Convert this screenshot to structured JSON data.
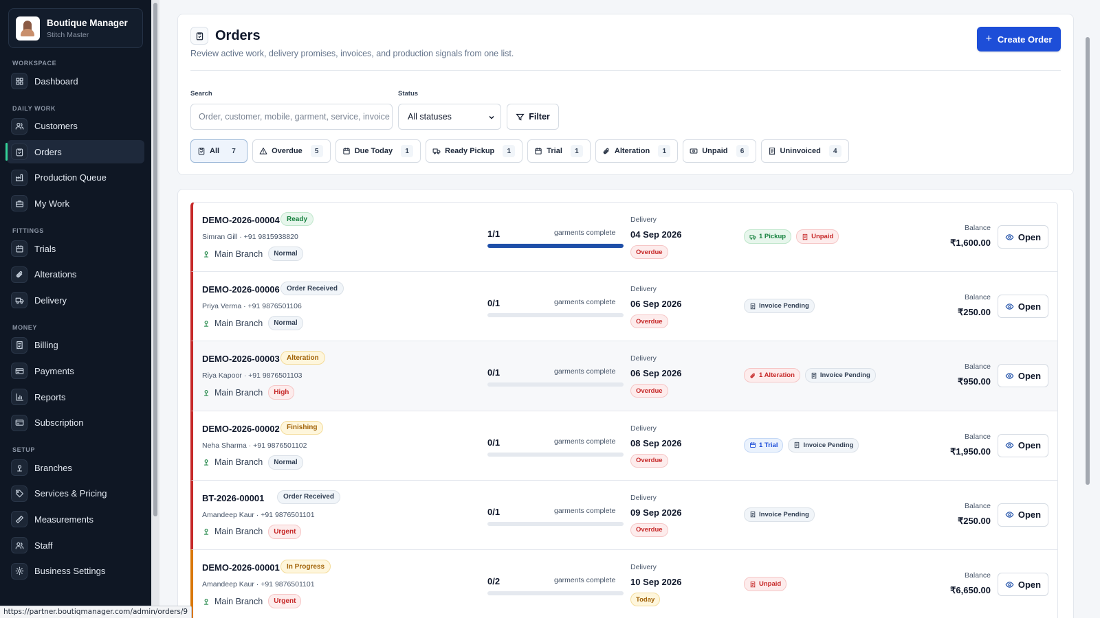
{
  "brand": {
    "name": "Boutique Manager",
    "subtitle": "Stitch Master"
  },
  "sidebar": {
    "sections": [
      {
        "label": "Workspace",
        "items": [
          {
            "label": "Dashboard",
            "icon": "dashboard-icon"
          }
        ]
      },
      {
        "label": "Daily Work",
        "items": [
          {
            "label": "Customers",
            "icon": "users-icon"
          },
          {
            "label": "Orders",
            "icon": "clipboard-icon",
            "active": true
          },
          {
            "label": "Production Queue",
            "icon": "factory-icon"
          },
          {
            "label": "My Work",
            "icon": "briefcase-icon"
          }
        ]
      },
      {
        "label": "Fittings",
        "items": [
          {
            "label": "Trials",
            "icon": "calendar-icon"
          },
          {
            "label": "Alterations",
            "icon": "paperclip-icon"
          },
          {
            "label": "Delivery",
            "icon": "truck-icon"
          }
        ]
      },
      {
        "label": "Money",
        "items": [
          {
            "label": "Billing",
            "icon": "receipt-icon"
          },
          {
            "label": "Payments",
            "icon": "card-icon"
          },
          {
            "label": "Reports",
            "icon": "chart-icon"
          },
          {
            "label": "Subscription",
            "icon": "card-icon"
          }
        ]
      },
      {
        "label": "Setup",
        "items": [
          {
            "label": "Branches",
            "icon": "pin-icon"
          },
          {
            "label": "Services & Pricing",
            "icon": "tag-icon"
          },
          {
            "label": "Measurements",
            "icon": "ruler-icon"
          },
          {
            "label": "Staff",
            "icon": "users-icon"
          },
          {
            "label": "Business Settings",
            "icon": "gear-icon"
          }
        ]
      }
    ]
  },
  "header": {
    "title": "Orders",
    "subtitle": "Review active work, delivery promises, invoices, and production signals from one list.",
    "create_label": "Create Order"
  },
  "filters": {
    "search_label": "Search",
    "search_placeholder": "Order, customer, mobile, garment, service, invoice",
    "status_label": "Status",
    "status_value": "All statuses",
    "filter_label": "Filter",
    "chips": [
      {
        "label": "All",
        "count": "7",
        "icon": "clipboard-icon",
        "active": true
      },
      {
        "label": "Overdue",
        "count": "5",
        "icon": "warning-icon"
      },
      {
        "label": "Due Today",
        "count": "1",
        "icon": "calendar-icon"
      },
      {
        "label": "Ready Pickup",
        "count": "1",
        "icon": "truck-icon"
      },
      {
        "label": "Trial",
        "count": "1",
        "icon": "calendar-icon"
      },
      {
        "label": "Alteration",
        "count": "1",
        "icon": "paperclip-icon"
      },
      {
        "label": "Unpaid",
        "count": "6",
        "icon": "cash-icon"
      },
      {
        "label": "Uninvoiced",
        "count": "4",
        "icon": "receipt-icon"
      }
    ]
  },
  "orders": [
    {
      "number": "DEMO-2026-00004",
      "status": "Ready",
      "status_kind": "ready",
      "customer": "Simran Gill · +91 9815938820",
      "branch": "Main Branch",
      "priority": "Normal",
      "priority_kind": "normal",
      "garments": "1/1",
      "progress": 1.0,
      "garments_label": "garments complete",
      "delivery_label": "Delivery",
      "delivery_date": "04 Sep 2026",
      "delivery_tag": "Overdue",
      "delivery_tag_kind": "overdue",
      "signals": [
        {
          "label": "1 Pickup",
          "kind": "pickup",
          "icon": "truck-icon"
        },
        {
          "label": "Unpaid",
          "kind": "unpaid",
          "icon": "receipt-icon"
        }
      ],
      "balance_label": "Balance",
      "balance": "₹1,600.00",
      "open_label": "Open",
      "accent": "red"
    },
    {
      "number": "DEMO-2026-00006",
      "status": "Order Received",
      "status_kind": "received",
      "customer": "Priya Verma · +91 9876501106",
      "branch": "Main Branch",
      "priority": "Normal",
      "priority_kind": "normal",
      "garments": "0/1",
      "progress": 0,
      "garments_label": "garments complete",
      "delivery_label": "Delivery",
      "delivery_date": "06 Sep 2026",
      "delivery_tag": "Overdue",
      "delivery_tag_kind": "overdue",
      "signals": [
        {
          "label": "Invoice Pending",
          "kind": "pending",
          "icon": "receipt-icon"
        }
      ],
      "balance_label": "Balance",
      "balance": "₹250.00",
      "open_label": "Open",
      "accent": "red"
    },
    {
      "number": "DEMO-2026-00003",
      "status": "Alteration",
      "status_kind": "alteration",
      "customer": "Riya Kapoor · +91 9876501103",
      "branch": "Main Branch",
      "priority": "High",
      "priority_kind": "high",
      "garments": "0/1",
      "progress": 0,
      "garments_label": "garments complete",
      "delivery_label": "Delivery",
      "delivery_date": "06 Sep 2026",
      "delivery_tag": "Overdue",
      "delivery_tag_kind": "overdue",
      "signals": [
        {
          "label": "1 Alteration",
          "kind": "alter",
          "icon": "paperclip-icon"
        },
        {
          "label": "Invoice Pending",
          "kind": "pending",
          "icon": "receipt-icon"
        }
      ],
      "balance_label": "Balance",
      "balance": "₹950.00",
      "open_label": "Open",
      "accent": "red",
      "highlight": true
    },
    {
      "number": "DEMO-2026-00002",
      "status": "Finishing",
      "status_kind": "alteration",
      "customer": "Neha Sharma · +91 9876501102",
      "branch": "Main Branch",
      "priority": "Normal",
      "priority_kind": "normal",
      "garments": "0/1",
      "progress": 0,
      "garments_label": "garments complete",
      "delivery_label": "Delivery",
      "delivery_date": "08 Sep 2026",
      "delivery_tag": "Overdue",
      "delivery_tag_kind": "overdue",
      "signals": [
        {
          "label": "1 Trial",
          "kind": "trial",
          "icon": "calendar-icon"
        },
        {
          "label": "Invoice Pending",
          "kind": "pending",
          "icon": "receipt-icon"
        }
      ],
      "balance_label": "Balance",
      "balance": "₹1,950.00",
      "open_label": "Open",
      "accent": "red"
    },
    {
      "number": "BT-2026-00001",
      "status": "Order Received",
      "status_kind": "received",
      "customer": "Amandeep Kaur · +91 9876501101",
      "branch": "Main Branch",
      "priority": "Urgent",
      "priority_kind": "urgent",
      "garments": "0/1",
      "progress": 0,
      "garments_label": "garments complete",
      "delivery_label": "Delivery",
      "delivery_date": "09 Sep 2026",
      "delivery_tag": "Overdue",
      "delivery_tag_kind": "overdue",
      "signals": [
        {
          "label": "Invoice Pending",
          "kind": "pending",
          "icon": "receipt-icon"
        }
      ],
      "balance_label": "Balance",
      "balance": "₹250.00",
      "open_label": "Open",
      "accent": "red"
    },
    {
      "number": "DEMO-2026-00001",
      "status": "In Progress",
      "status_kind": "progress",
      "customer": "Amandeep Kaur · +91 9876501101",
      "branch": "Main Branch",
      "priority": "Urgent",
      "priority_kind": "urgent",
      "garments": "0/2",
      "progress": 0,
      "garments_label": "garments complete",
      "delivery_label": "Delivery",
      "delivery_date": "10 Sep 2026",
      "delivery_tag": "Today",
      "delivery_tag_kind": "today",
      "signals": [
        {
          "label": "Unpaid",
          "kind": "unpaid",
          "icon": "receipt-icon"
        }
      ],
      "balance_label": "Balance",
      "balance": "₹6,650.00",
      "open_label": "Open",
      "accent": "orange"
    }
  ],
  "status_url": "https://partner.boutiqmanager.com/admin/orders/9"
}
